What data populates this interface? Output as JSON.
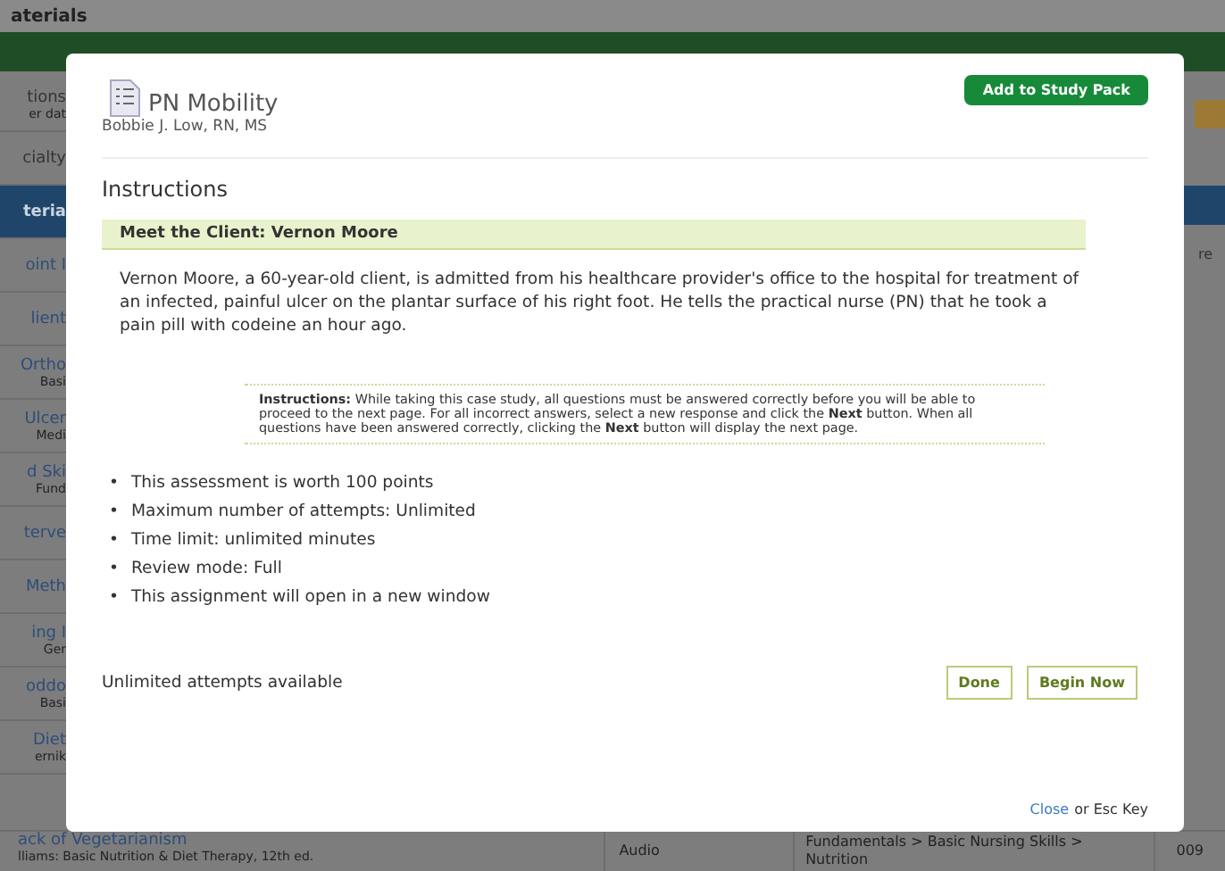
{
  "page": {
    "title": "aterials",
    "left_rows": [
      {
        "title": "tions",
        "subtitle": "er dat",
        "kind": "plain"
      },
      {
        "title": "cialty",
        "kind": "plain"
      },
      {
        "title": "teria",
        "kind": "header"
      },
      {
        "title": "oint I",
        "kind": "link"
      },
      {
        "title": "lient",
        "kind": "link"
      },
      {
        "title": "Ortho",
        "subtitle": "Basi",
        "kind": "link"
      },
      {
        "title": "Ulcer",
        "subtitle": "Medi",
        "kind": "link"
      },
      {
        "title": "d Ski",
        "subtitle": "Fund",
        "kind": "link"
      },
      {
        "title": "terve",
        "kind": "link"
      },
      {
        "title": "Meth",
        "kind": "link"
      },
      {
        "title": "ing I",
        "subtitle": "Ger",
        "kind": "link"
      },
      {
        "title": "oddo",
        "subtitle": "Basi",
        "kind": "link"
      },
      {
        "title": "Diet",
        "subtitle": "ernik",
        "kind": "link"
      }
    ],
    "right_fragment": "re",
    "bottom_row": {
      "title": "ack of Vegetarianism",
      "subtitle": "lliams: Basic Nutrition & Diet Therapy, 12th ed.",
      "type": "Audio",
      "category": "Fundamentals > Basic Nursing Skills > Nutrition",
      "code": "009"
    }
  },
  "modal": {
    "title": "PN Mobility",
    "author": "Bobbie J. Low, RN, MS",
    "add_button": "Add to Study Pack",
    "heading": "Instructions",
    "banner": "Meet the Client: Vernon Moore",
    "paragraph": "Vernon Moore, a 60-year-old client, is admitted from his healthcare provider's office to the hospital for treatment of an infected, painful ulcer on the plantar surface of his right foot. He tells the practical nurse (PN) that he took a pain pill with codeine an hour ago.",
    "note": "**Instructions:** While taking this case study, all questions must be answered correctly before you will be able to proceed to the next page. For all incorrect answers, select a new response and click the **Next** button. When all questions have been answered correctly, clicking the **Next** button will display the next page.",
    "bullets": [
      {
        "marker": "•",
        "text": "This assessment is worth 100 points"
      },
      {
        "marker": "•",
        "text": "Maximum number of attempts: Unlimited"
      },
      {
        "marker": "•",
        "text": "Time limit: unlimited minutes"
      },
      {
        "marker": "•",
        "text": "Review mode: Full"
      },
      {
        "marker": "•",
        "text": "This assignment will open in a new window"
      }
    ],
    "attempts": "Unlimited attempts available",
    "buttons": [
      "Done",
      "Begin Now"
    ],
    "close_link": "Close",
    "close_hint": "or Esc Key"
  }
}
